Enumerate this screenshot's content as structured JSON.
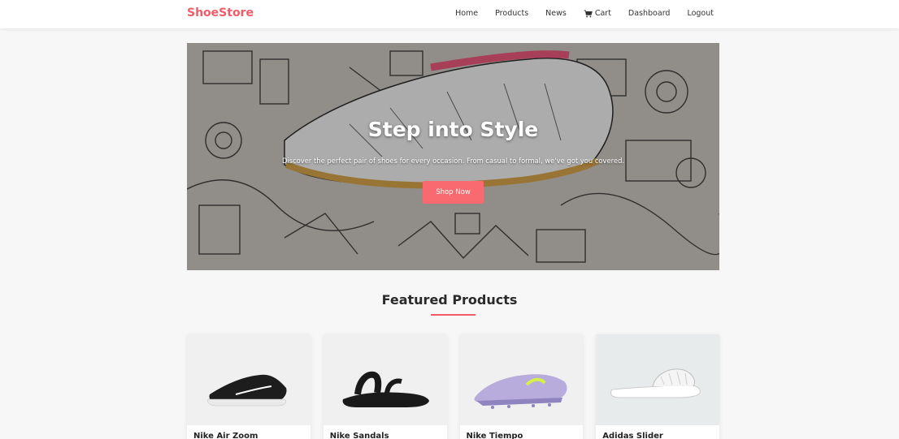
{
  "navbar": {
    "brand": "ShoeStore",
    "links": [
      {
        "label": "Home"
      },
      {
        "label": "Products"
      },
      {
        "label": "News"
      },
      {
        "label": "Cart",
        "icon": "cart-icon"
      },
      {
        "label": "Dashboard"
      },
      {
        "label": "Logout"
      }
    ]
  },
  "hero": {
    "title": "Step into Style",
    "subtitle": "Discover the perfect pair of shoes for every occasion. From casual to formal, we've got you covered.",
    "button": "Shop Now"
  },
  "featured": {
    "title": "Featured Products",
    "products": [
      {
        "name": "Nike Air Zoom"
      },
      {
        "name": "Nike Sandals"
      },
      {
        "name": "Nike Tiempo"
      },
      {
        "name": "Adidas Slider"
      }
    ]
  },
  "colors": {
    "accent": "#f25c67",
    "button": "#f86a6f"
  }
}
